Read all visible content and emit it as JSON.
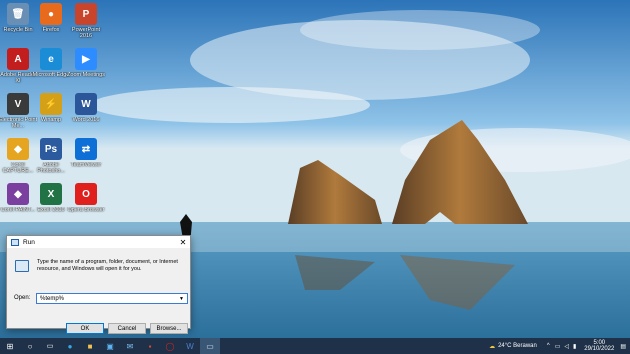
{
  "desktop": {
    "icons": [
      {
        "label": "Recycle Bin",
        "glyph": "🗑",
        "color": "#6a8fb5"
      },
      {
        "label": "Firefox",
        "glyph": "●",
        "color": "#e86a1c"
      },
      {
        "label": "PowerPoint 2016",
        "glyph": "P",
        "color": "#c8442b"
      },
      {
        "label": "Adobe Reader XI",
        "glyph": "A",
        "color": "#c21e1e"
      },
      {
        "label": "Microsoft Edge",
        "glyph": "e",
        "color": "#1a8dd6"
      },
      {
        "label": "Zoom Meetings",
        "glyph": "▶",
        "color": "#2d8cff"
      },
      {
        "label": "Electronic Point Me...",
        "glyph": "V",
        "color": "#3a3a3a"
      },
      {
        "label": "Winamp",
        "glyph": "⚡",
        "color": "#d4a017"
      },
      {
        "label": "Word 2016",
        "glyph": "W",
        "color": "#2b579a"
      },
      {
        "label": "Corel CAPTURE...",
        "glyph": "◆",
        "color": "#e6a520"
      },
      {
        "label": "Adobe Photosho...",
        "glyph": "Ps",
        "color": "#2b5b9e"
      },
      {
        "label": "TeamViewer",
        "glyph": "⇄",
        "color": "#0e6fd6"
      },
      {
        "label": "Corel PAINT...",
        "glyph": "◆",
        "color": "#7b3fa0"
      },
      {
        "label": "Excel 2016",
        "glyph": "X",
        "color": "#217346"
      },
      {
        "label": "Opera Browser",
        "glyph": "O",
        "color": "#e0201c"
      }
    ]
  },
  "run_dialog": {
    "title": "Run",
    "close": "✕",
    "description": "Type the name of a program, folder, document, or Internet resource, and Windows will open it for you.",
    "open_label": "Open:",
    "open_value": "%temp%",
    "ok": "OK",
    "cancel": "Cancel",
    "browse": "Browse..."
  },
  "taskbar": {
    "weather": "24°C  Berawan",
    "time": "5:00",
    "date": "29/10/2022"
  }
}
